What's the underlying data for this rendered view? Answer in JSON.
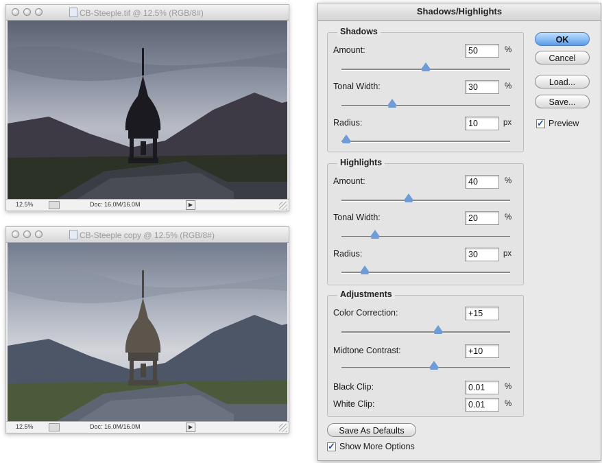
{
  "windows": [
    {
      "title": "CB-Steeple.tif @ 12.5% (RGB/8#)",
      "zoom": "12.5%",
      "doc_size": "Doc: 16.0M/16.0M"
    },
    {
      "title": "CB-Steeple copy @ 12.5% (RGB/8#)",
      "zoom": "12.5%",
      "doc_size": "Doc: 16.0M/16.0M"
    }
  ],
  "dialog": {
    "title": "Shadows/Highlights",
    "shadows": {
      "legend": "Shadows",
      "amount": {
        "label": "Amount:",
        "value": "50",
        "unit": "%",
        "level": 0.5
      },
      "tonal_width": {
        "label": "Tonal Width:",
        "value": "30",
        "unit": "%",
        "level": 0.3
      },
      "radius": {
        "label": "Radius:",
        "value": "10",
        "unit": "px",
        "level": 0.03
      }
    },
    "highlights": {
      "legend": "Highlights",
      "amount": {
        "label": "Amount:",
        "value": "40",
        "unit": "%",
        "level": 0.4
      },
      "tonal_width": {
        "label": "Tonal Width:",
        "value": "20",
        "unit": "%",
        "level": 0.2
      },
      "radius": {
        "label": "Radius:",
        "value": "30",
        "unit": "px",
        "level": 0.14
      }
    },
    "adjustments": {
      "legend": "Adjustments",
      "color_correction": {
        "label": "Color Correction:",
        "value": "+15",
        "level": 0.575
      },
      "midtone_contrast": {
        "label": "Midtone Contrast:",
        "value": "+10",
        "level": 0.55
      },
      "black_clip": {
        "label": "Black Clip:",
        "value": "0.01",
        "unit": "%"
      },
      "white_clip": {
        "label": "White Clip:",
        "value": "0.01",
        "unit": "%"
      }
    },
    "buttons": {
      "ok": "OK",
      "cancel": "Cancel",
      "load": "Load...",
      "save": "Save...",
      "save_defaults": "Save As Defaults"
    },
    "preview": {
      "label": "Preview",
      "checked": true
    },
    "show_more": {
      "label": "Show More Options",
      "checked": true
    }
  },
  "colors": {
    "accent": "#5a9be8",
    "slider_thumb": "#6f9cd6"
  },
  "icons": [
    "traffic-light-close-icon",
    "traffic-light-minimize-icon",
    "traffic-light-zoom-icon",
    "document-icon",
    "checkmark-icon",
    "triangle-slider-icon"
  ]
}
